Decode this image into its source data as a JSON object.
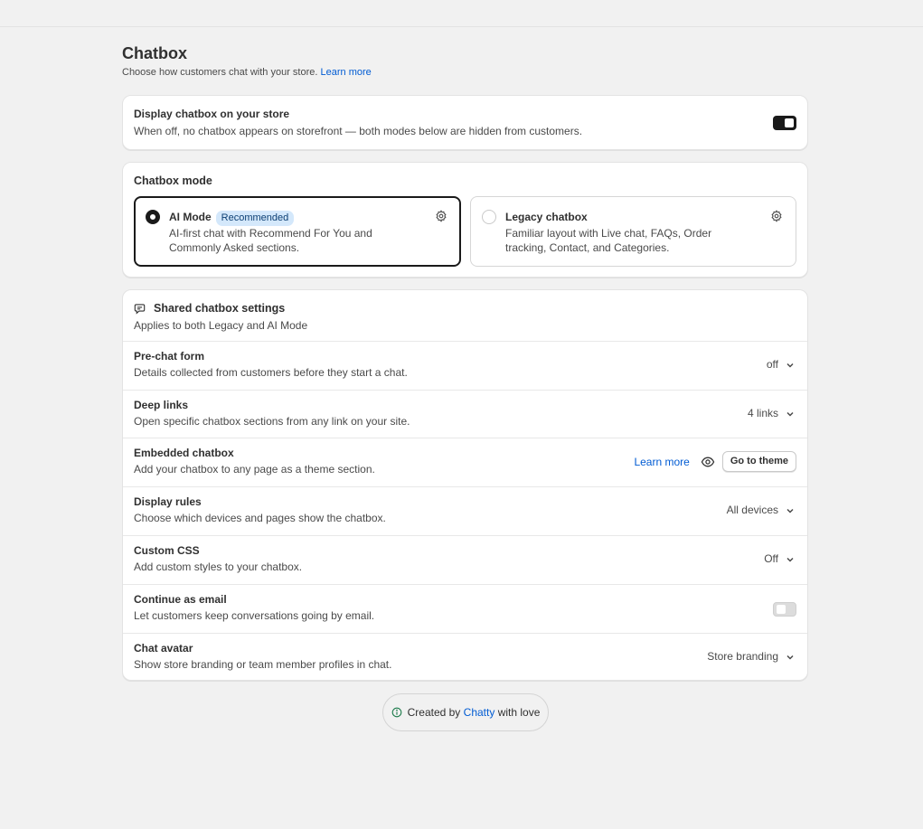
{
  "header": {
    "title": "Chatbox",
    "subtitle": "Choose how customers chat with your store.",
    "learn_more": "Learn more"
  },
  "display": {
    "title": "Display chatbox on your store",
    "description": "When off, no chatbox appears on storefront — both modes below are hidden from customers.",
    "enabled": true
  },
  "mode": {
    "title": "Chatbox mode",
    "options": [
      {
        "name": "AI Mode",
        "badge": "Recommended",
        "description": "AI-first chat with Recommend For You and Commonly Asked sections.",
        "selected": true
      },
      {
        "name": "Legacy chatbox",
        "description": "Familiar layout with Live chat, FAQs, Order tracking, Contact, and Categories.",
        "selected": false
      }
    ]
  },
  "shared": {
    "title": "Shared chatbox settings",
    "subtitle": "Applies to both Legacy and AI Mode",
    "rows": [
      {
        "title": "Pre-chat form",
        "description": "Details collected from customers before they start a chat.",
        "value": "off"
      },
      {
        "title": "Deep links",
        "description": "Open specific chatbox sections from any link on your site.",
        "value": "4 links"
      },
      {
        "title": "Embedded chatbox",
        "description": "Add your chatbox to any page as a theme section.",
        "learn_more": "Learn more",
        "button": "Go to theme"
      },
      {
        "title": "Display rules",
        "description": "Choose which devices and pages show the chatbox.",
        "value": "All devices"
      },
      {
        "title": "Custom CSS",
        "description": "Add custom styles to your chatbox.",
        "value": "Off"
      },
      {
        "title": "Continue as email",
        "description": "Let customers keep conversations going by email.",
        "toggle": false
      },
      {
        "title": "Chat avatar",
        "description": "Show store branding or team member profiles in chat.",
        "value": "Store branding"
      }
    ]
  },
  "footer": {
    "prefix": "Created by",
    "brand": "Chatty",
    "suffix": "with love"
  },
  "colors": {
    "accent": "#005bd3",
    "badge_bg": "#d4e8fb",
    "dark": "#1a1a1a",
    "page_bg": "#f1f1f1"
  }
}
